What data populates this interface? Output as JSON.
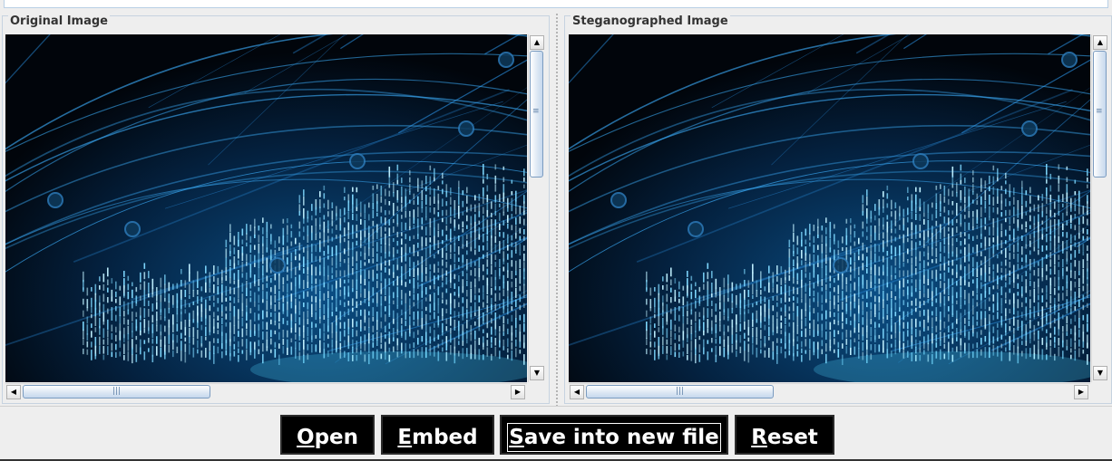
{
  "panels": {
    "original": {
      "title": "Original Image"
    },
    "stego": {
      "title": "Steganographed Image"
    }
  },
  "scrollbars": {
    "up_arrow": "▲",
    "down_arrow": "▼",
    "left_arrow": "◀",
    "right_arrow": "▶",
    "v_grip": "≡",
    "h_grip": "|||"
  },
  "buttons": {
    "open": {
      "mnemonic": "O",
      "rest": "pen"
    },
    "embed": {
      "mnemonic": "E",
      "rest": "mbed"
    },
    "save": {
      "mnemonic": "S",
      "rest": "ave into new file"
    },
    "reset": {
      "mnemonic": "R",
      "rest": "eset"
    }
  },
  "colors": {
    "image_background": "#02060c",
    "circuit_glow": "#2fa6ff",
    "button_bg": "#000000",
    "button_fg": "#ffffff"
  }
}
